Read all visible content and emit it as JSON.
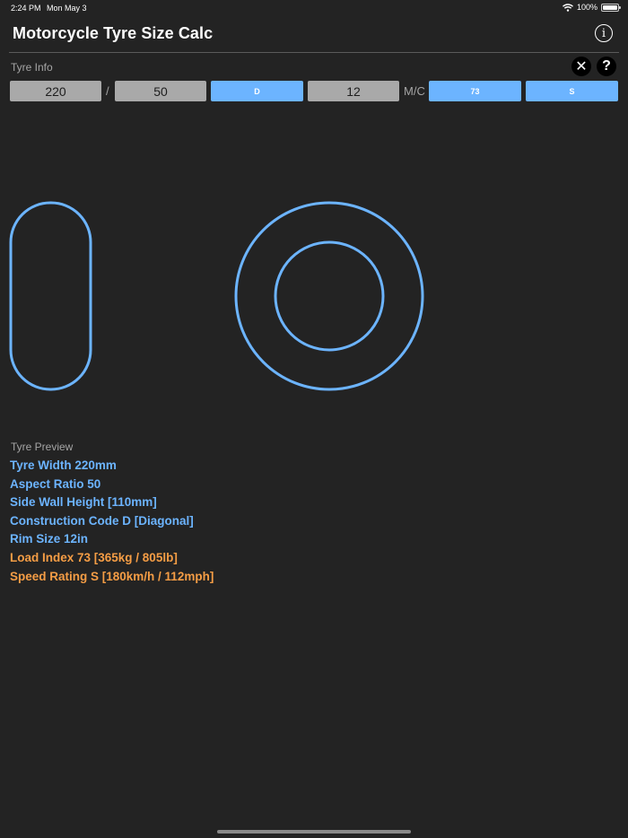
{
  "status_bar": {
    "time": "2:24 PM",
    "date": "Mon May 3",
    "battery": "100%",
    "battery_level": 1.0
  },
  "header": {
    "title": "Motorcycle Tyre Size Calc",
    "info_icon": "info-circle-icon"
  },
  "tyre_info": {
    "label": "Tyre Info",
    "clear_icon": "close-icon",
    "help_icon": "question-icon",
    "width": "220",
    "slash": "/",
    "aspect_ratio": "50",
    "construction_code": "D",
    "rim_size": "12",
    "mc_label": "M/C",
    "load_index": "73",
    "speed_rating": "S"
  },
  "colors": {
    "accent_blue": "#6cb4ff",
    "accent_orange": "#f59d45",
    "field_grey": "#a9a9a9",
    "background": "#232323"
  },
  "preview": {
    "label": "Tyre Preview",
    "lines": [
      {
        "text": "Tyre Width 220mm",
        "color": "blue"
      },
      {
        "text": "Aspect Ratio 50",
        "color": "blue"
      },
      {
        "text": "Side Wall Height [110mm]",
        "color": "blue"
      },
      {
        "text": "Construction Code D [Diagonal]",
        "color": "blue"
      },
      {
        "text": "Rim Size 12in",
        "color": "blue"
      },
      {
        "text": "Load Index 73 [365kg / 805lb]",
        "color": "orange"
      },
      {
        "text": "Speed Rating S [180km/h / 112mph]",
        "color": "orange"
      }
    ]
  }
}
